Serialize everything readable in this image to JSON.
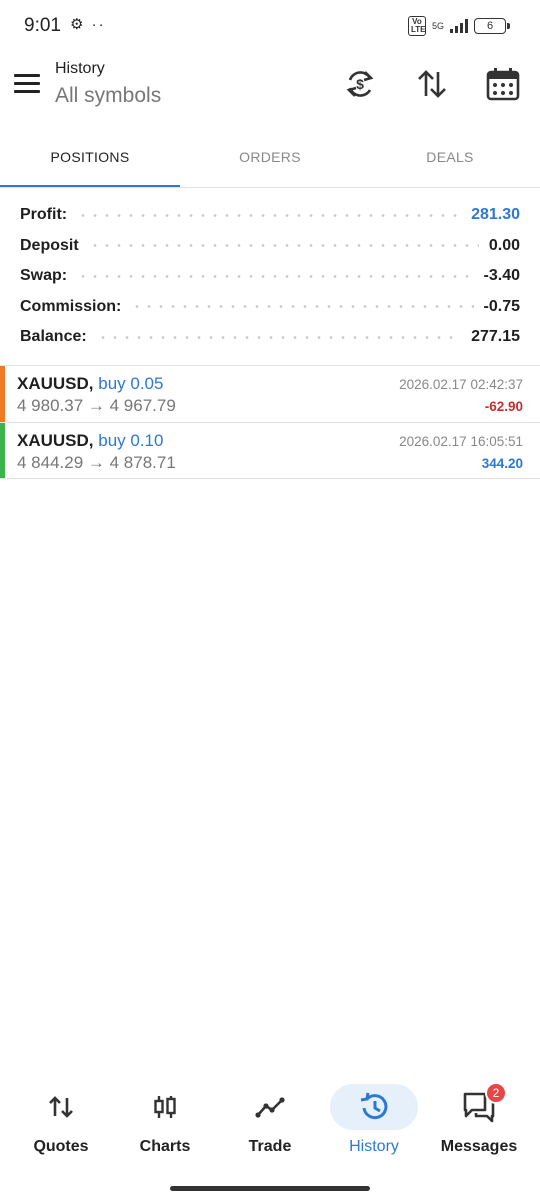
{
  "status_bar": {
    "time": "9:01",
    "left_icons": "⚙ ··",
    "volte": "Vo LTE",
    "network": "5G",
    "battery": "6"
  },
  "header": {
    "title": "History",
    "subtitle": "All symbols",
    "icons": [
      "menu-icon",
      "currency-exchange-icon",
      "sort-icon",
      "calendar-icon"
    ]
  },
  "tabs": [
    {
      "label": "POSITIONS",
      "active": true
    },
    {
      "label": "ORDERS",
      "active": false
    },
    {
      "label": "DEALS",
      "active": false
    }
  ],
  "summary": [
    {
      "label": "Profit:",
      "value": "281.30",
      "highlight": true
    },
    {
      "label": "Deposit",
      "value": "0.00",
      "highlight": false
    },
    {
      "label": "Swap:",
      "value": "-3.40",
      "highlight": false
    },
    {
      "label": "Commission:",
      "value": "-0.75",
      "highlight": false
    },
    {
      "label": "Balance:",
      "value": "277.15",
      "highlight": false
    }
  ],
  "positions": [
    {
      "symbol": "XAUUSD,",
      "side": "buy 0.05",
      "prices": "4 980.37 → 4 967.79",
      "time": "2026.02.17 02:42:37",
      "profit": "-62.90",
      "bar_color": "#f07a24",
      "profit_color": "#c9302c"
    },
    {
      "symbol": "XAUUSD,",
      "side": "buy 0.10",
      "prices": "4 844.29 → 4 878.71",
      "time": "2026.02.17 16:05:51",
      "profit": "344.20",
      "bar_color": "#3cb44b",
      "profit_color": "#2e78d2"
    }
  ],
  "bottom_nav": [
    {
      "label": "Quotes",
      "icon": "quotes-icon",
      "active": false
    },
    {
      "label": "Charts",
      "icon": "charts-icon",
      "active": false
    },
    {
      "label": "Trade",
      "icon": "trade-icon",
      "active": false
    },
    {
      "label": "History",
      "icon": "history-icon",
      "active": true
    },
    {
      "label": "Messages",
      "icon": "messages-icon",
      "active": false,
      "badge": "2"
    }
  ],
  "colors": {
    "accent": "#2e78d2",
    "loss": "#c9302c",
    "active_nav_bg": "#e6f0fb",
    "badge": "#e74646"
  }
}
